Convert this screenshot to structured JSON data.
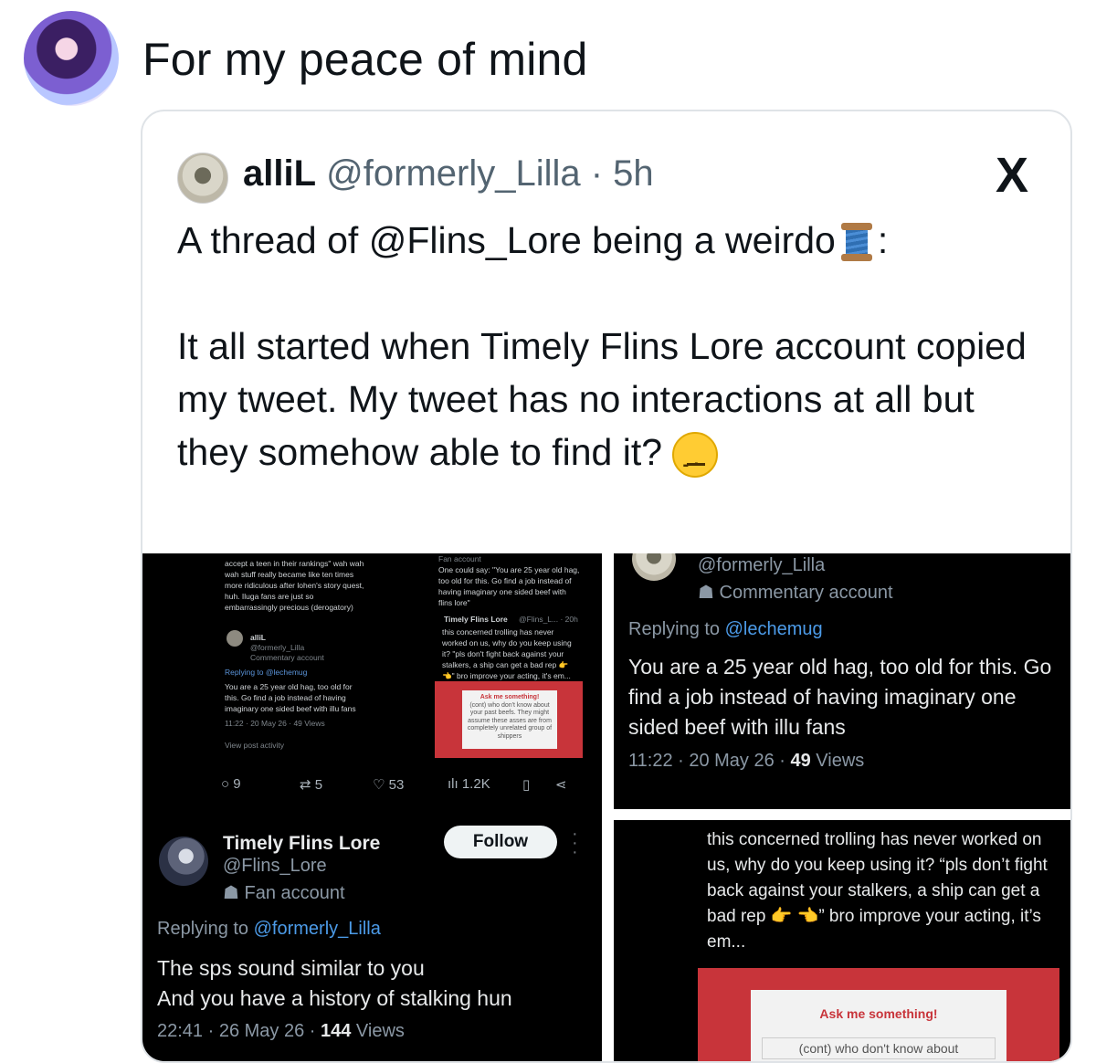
{
  "post": {
    "title": "For my peace of mind"
  },
  "quote": {
    "name": "alliL",
    "handle": "@formerly_Lilla",
    "time": "· 5h",
    "logo": "X",
    "line1_a": "A thread of @Flins_Lore being a weirdo",
    "line1_b": ":",
    "body": "It all started when Timely Flins Lore account copied my tweet. My tweet has no interactions at all but they somehow able to find it?"
  },
  "left_top": {
    "frag1": "accept a teen in their rankings\" wah wah",
    "frag2": "wah stuff really became like ten times",
    "frag3": "more ridiculous after lohen's story quest,",
    "frag4": "huh. Iluga fans are just so",
    "frag5": "embarrassingly precious (derogatory)",
    "name": "alliL",
    "handle": "@formerly_Lilla",
    "tag": "Commentary account",
    "replying": "Replying to @lechemug",
    "t1": "You are a 25 year old hag, too old for",
    "t2": "this. Go find a job instead of having",
    "t3": "imaginary one sided beef with illu fans",
    "meta": "11:22 · 20 May 26 · 49 Views",
    "activity": "View post activity",
    "fan": "Fan account",
    "r1": "One could say: \"You are 25 year old hag,",
    "r2": "too old for this. Go find a job instead of",
    "r3": "having imaginary one sided beef with",
    "r4": "flins lore\"",
    "name2": "Timely Flins Lore",
    "h2": "@Flins_L... · 20h",
    "s1": "this concerned trolling has never",
    "s2": "worked on us, why do you keep using",
    "s3": "it? \"pls don't fight back against your",
    "s4": "stalkers, a ship can get a bad rep 👉",
    "s5": "👈\" bro improve your acting, it's em...",
    "ask": "Ask me something!",
    "c1": "(cont) who don't know about",
    "c2": "your past beefs. They might",
    "c3": "assume these asses are from",
    "c4": "completely unrelated group of",
    "c5": "shippers",
    "replies": "9",
    "reposts": "5",
    "likes": "53",
    "views": "1.2K"
  },
  "left_bottom": {
    "name": "Timely Flins Lore",
    "handle": "@Flins_Lore",
    "tag": "Fan account",
    "follow": "Follow",
    "replying_prefix": "Replying to ",
    "replying_link": "@formerly_Lilla",
    "line1": "The sps sound similar to you",
    "line2": "And you have a history of stalking hun",
    "meta_prefix": "22:41 · 26 May 26 · ",
    "views_count": "144",
    "views_word": " Views"
  },
  "right_top": {
    "handle": "@formerly_Lilla",
    "tag": "Commentary account",
    "replying_prefix": "Replying to ",
    "replying_link": "@lechemug",
    "text": "You are a 25 year old hag, too old for this. Go find a job instead of having imaginary one sided beef with illu fans",
    "meta_prefix": "11:22 · 20 May 26 · ",
    "views_count": "49",
    "views_word": " Views"
  },
  "right_bottom": {
    "text": "this concerned trolling has never worked on us, why do you keep using it? “pls don’t fight back against your stalkers, a ship can get a bad rep 👉 👈” bro improve your acting, it’s em...",
    "ask": "Ask me something!",
    "cont": "(cont) who don't know about"
  }
}
